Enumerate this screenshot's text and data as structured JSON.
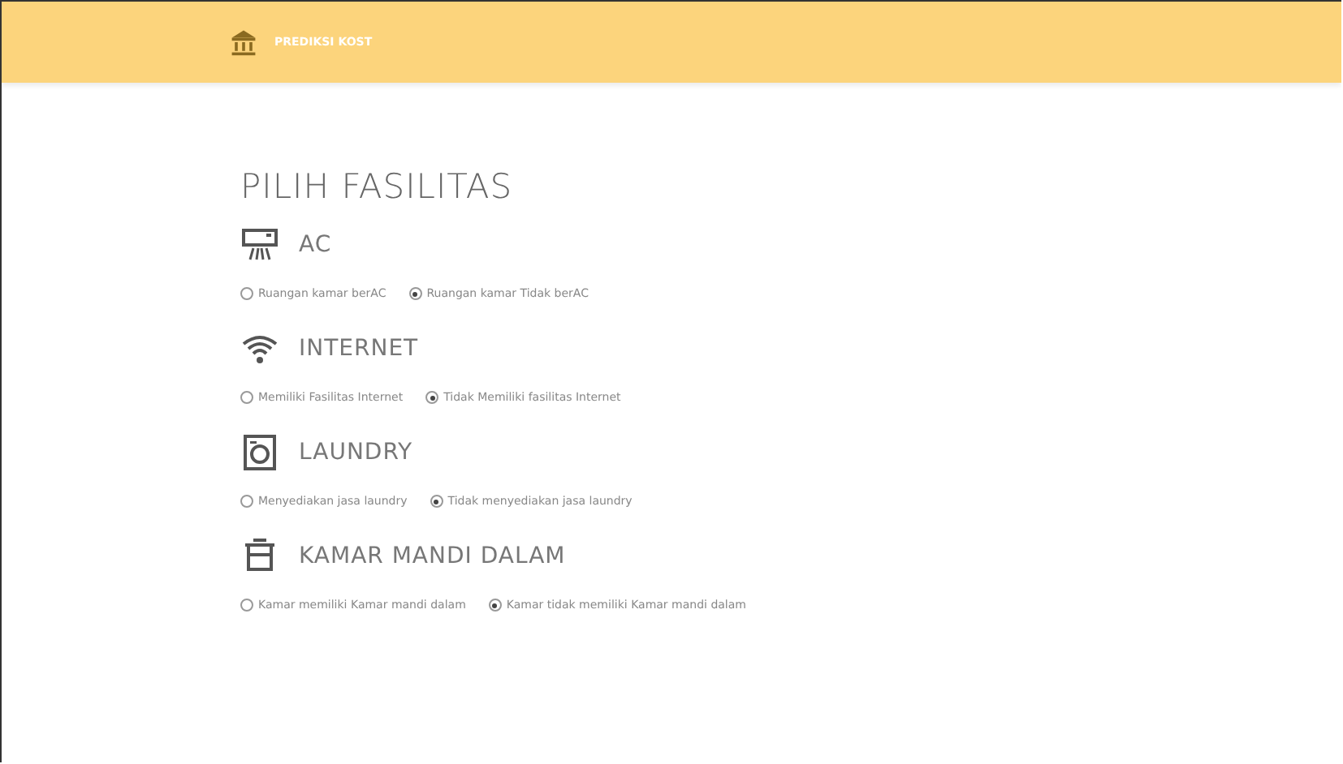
{
  "header": {
    "brand": "PREDIKSI KOST"
  },
  "title": "PILIH FASILITAS",
  "sections": [
    {
      "kind": "ac",
      "heading": "AC",
      "options": [
        {
          "label": "Ruangan kamar berAC",
          "selected": false
        },
        {
          "label": "Ruangan kamar Tidak berAC",
          "selected": true
        }
      ]
    },
    {
      "kind": "wifi",
      "heading": "INTERNET",
      "options": [
        {
          "label": "Memiliki Fasilitas Internet",
          "selected": false
        },
        {
          "label": "Tidak Memiliki fasilitas Internet",
          "selected": true
        }
      ]
    },
    {
      "kind": "laundry",
      "heading": "LAUNDRY",
      "options": [
        {
          "label": "Menyediakan jasa laundry",
          "selected": false
        },
        {
          "label": "Tidak menyediakan jasa laundry",
          "selected": true
        }
      ]
    },
    {
      "kind": "bath",
      "heading": "KAMAR MANDI DALAM",
      "options": [
        {
          "label": "Kamar memiliki Kamar mandi dalam",
          "selected": false
        },
        {
          "label": "Kamar tidak memiliki Kamar mandi dalam",
          "selected": true
        }
      ]
    }
  ]
}
